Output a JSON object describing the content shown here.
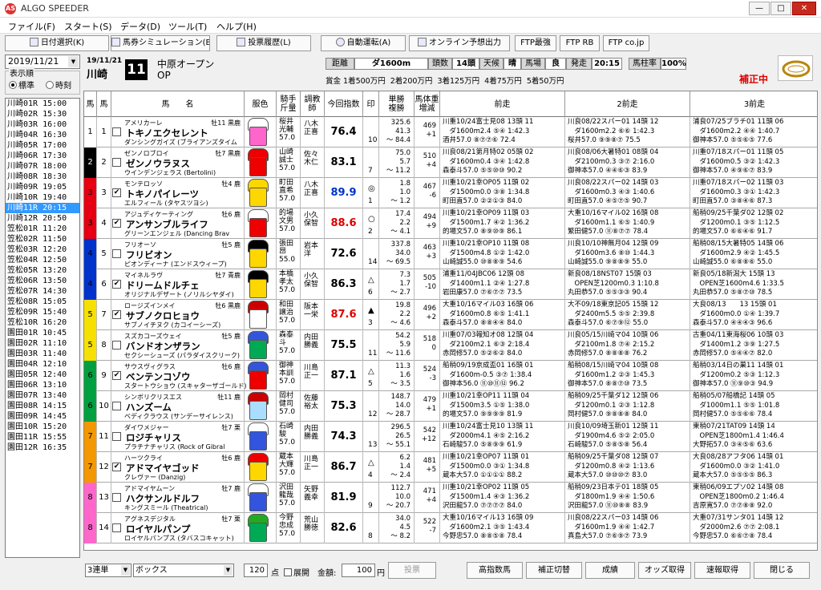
{
  "window": {
    "title": "ALGO SPEEDER",
    "app_icon": "AS"
  },
  "menu": [
    "ファイル(F)",
    "スタート(S)",
    "データ(D)",
    "ツール(T)",
    "ヘルプ(H)"
  ],
  "toolbar": [
    {
      "label": "日付選択(K)",
      "icon": "search-icon"
    },
    {
      "label": "馬券シミュレーション(B)",
      "icon": "ticket-icon"
    },
    {
      "label": "投票履歴(L)",
      "icon": "document-icon"
    },
    {
      "label": "自動運転(A)",
      "icon": "disc-icon"
    },
    {
      "label": "オンライン予想出力",
      "icon": "document-icon"
    },
    {
      "label": "FTP最強",
      "icon": ""
    },
    {
      "label": "FTP RB",
      "icon": ""
    },
    {
      "label": "FTP co.jp",
      "icon": ""
    }
  ],
  "left": {
    "date": "2019/11/21",
    "order_label": "表示順",
    "order_std": "標準",
    "order_time": "時刻",
    "races": [
      "川崎01R 15:00",
      "川崎02R 15:30",
      "川崎03R 16:00",
      "川崎04R 16:30",
      "川崎05R 17:00",
      "川崎06R 17:30",
      "川崎07R 18:00",
      "川崎08R 18:30",
      "川崎09R 19:05",
      "川崎10R 19:40",
      "川崎11R 20:15",
      "川崎12R 20:50",
      "笠松01R 11:20",
      "笠松02R 11:50",
      "笠松03R 12:20",
      "笠松04R 12:50",
      "笠松05R 13:20",
      "笠松06R 13:50",
      "笠松07R 14:30",
      "笠松08R 15:05",
      "笠松09R 15:40",
      "笠松10R 16:20",
      "園田01R 10:45",
      "園田02R 11:10",
      "園田03R 11:40",
      "園田04R 12:10",
      "園田05R 12:40",
      "園田06R 13:10",
      "園田07R 13:40",
      "園田08R 14:15",
      "園田09R 14:45",
      "園田10R 15:20",
      "園田11R 15:55",
      "園田12R 16:35"
    ],
    "selected": 10
  },
  "race": {
    "date": "19/11/21",
    "venue": "川崎",
    "number": "11",
    "name": "中原オープン",
    "class": "OP",
    "dist_label": "距離",
    "dist": "ダ1600m",
    "heads_label": "頭数",
    "heads": "14頭",
    "weather_label": "天候",
    "weather": "晴",
    "track_label": "馬場",
    "track": "良",
    "post_label": "発走",
    "post": "20:15",
    "rate_label": "馬柱率",
    "rate": "100%",
    "prize": "賞金 1着500万円  2着200万円  3着125万円  4着75万円  5着50万円",
    "hosei": "補正中"
  },
  "columns": [
    "馬",
    "馬",
    "馬　　名",
    "服色",
    "騎手\n斤量",
    "調教師",
    "今回指数",
    "印",
    "単勝\n複勝",
    "馬体重\n増減",
    "前走",
    "2前走",
    "3前走"
  ],
  "horses": [
    {
      "waku": "1",
      "num": "1",
      "chk": false,
      "sire": "アメリカーレ",
      "sex": "牡11 黒鹿",
      "name": "トキノエクセレント",
      "dam": "ダンシングガイズ (ブライアンズタイム",
      "jockey": "桜井\n光輔\n57.0",
      "trainer": "八木\n正喜",
      "index": "76.4",
      "idxcolor": "#000",
      "mark": "",
      "rank": "10",
      "odds": "325.6\n41.3\n～ 84.4",
      "weight": "469\n+1",
      "p1": "川重10/24富士見08 13頭 11\n　ダ1600m2.4 ⑤④ 1:42.3\n酒井57.0 ⑧⑦⑦⑥ 72.4",
      "p2": "川良08/22スパー01 14頭 12\n　ダ1600m2.2 ⑥⑥ 1:42.3\n桜井57.0 ⑨⑨⑧⑦ 75.5",
      "p3": "浦良07/25ブラチ01 11頭 06\n　ダ1600m2.2 ④④ 1:40.7\n御神本57.0 ⑤⑤⑥⑤ 77.6"
    },
    {
      "waku": "2",
      "num": "2",
      "chk": false,
      "sire": "ゼンノロブロイ",
      "sex": "牡7 黒鹿",
      "name": "ゼンノウラヌス",
      "dam": "ウインデンジェラス (Bertolini)",
      "jockey": "山崎\n誠士\n57.0",
      "trainer": "佐々\n木仁",
      "index": "83.1",
      "idxcolor": "#000",
      "mark": "",
      "rank": "7",
      "odds": "75.0\n5.7\n～ 11.2",
      "weight": "510\n+4",
      "p1": "川良08/21第月特02 05頭 02\n　ダ1600m0.4 ③④ 1:42.8\n森泰斗57.0 ⑤⑤⑩⑩ 90.2",
      "p2": "川良08/06大暑特01 08頭 04\n　ダ2100m0.3 ③⑦ 2:16.0\n御神本57.0 ④④⑥③ 83.9",
      "p3": "川重07/18スパー01 11頭 05\n　ダ1600m0.5 ③② 1:42.3\n御神本57.0 ④⑨⑥⑦ 83.9"
    },
    {
      "waku": "3",
      "num": "3",
      "chk": true,
      "sire": "モンテロッソ",
      "sex": "牡4 鹿",
      "name": "トキノパイレーツ",
      "dam": "エルフィール (タヤスツヨシ)",
      "jockey": "町田\n直希\n57.0",
      "trainer": "八木\n正喜",
      "index": "89.9",
      "idxcolor": "#0033cc",
      "mark": "◎",
      "rank": "1",
      "odds": "1.8\n1.0\n～ 1.2",
      "weight": "467\n-6",
      "p1": "川重10/21幸OP05 11頭 02\n　ダ1500m0.0 ③⑧ 1:34.8\n町田直57.0 ②②①③ 84.0",
      "p2": "川良08/22スパー02 14頭 03\n　ダ1600m0.3 ④③ 1:40.6\n町田直57.0 ④⑤⑦⑤ 90.7",
      "p3": "川重07/18スパー02 11頭 03\n　ダ1600m0.3 ③① 1:42.3\n町田直57.0 ③⑧④⑥ 87.3"
    },
    {
      "waku": "3",
      "num": "4",
      "chk": true,
      "sire": "アジュディケーティング",
      "sex": "牡6 鹿",
      "name": "アンサンブルライフ",
      "dam": "グリーンエンジェル (Dancing Brav",
      "jockey": "的場\n文男\n57.0",
      "trainer": "小久\n保智",
      "index": "88.6",
      "idxcolor": "#d00",
      "mark": "○",
      "rank": "2",
      "odds": "17.4\n2.2\n～ 4.1",
      "weight": "494\n+9",
      "p1": "川重10/21幸OP09 11頭 03\n　ダ1500m1.7 ④② 1:36.2\n的場文57.0 ⑧⑨⑩⑨ 86.1",
      "p2": "大重10/16マイル02 16頭 08\n　ダ1600m1.1 ⑥⑤ 1:40.9\n繁田健57.0 ⑪⑧⑦⑦ 78.4",
      "p3": "船稍09/25千葉ダ02 12頭 02\n　ダ1200m0.1 ③⑤ 1:12.5\n的場文57.0 ⑥⑥④⑥ 91.7"
    },
    {
      "waku": "4",
      "num": "5",
      "chk": false,
      "sire": "フリオーソ",
      "sex": "牡5 鹿",
      "name": "フリビオン",
      "dam": "ピオンディーナ (エンドスウィープ)",
      "jockey": "張田\n昂\n55.0",
      "trainer": "岩本\n洋",
      "index": "72.6",
      "idxcolor": "#000",
      "mark": "",
      "rank": "14",
      "odds": "337.8\n34.0\n～ 69.5",
      "weight": "463\n+3",
      "p1": "川重10/21幸OP10 11頭 08\n　ダ1500m4.8 ①② 1:42.0\n山崎誠55.0 ⑩⑧⑧⑨ 54.6",
      "p2": "川良10/10神無月04 12頭 09\n　ダ1600m3.6 ⑧⑩ 1:44.3\n山崎誠55.0 ⑨⑧⑧⑨ 55.0",
      "p3": "船稍08/15大暑特05 14頭 06\n　ダ1600m2.9 ④② 1:45.5\n山崎誠55.0 ⑥⑧⑧⑥ 55.0"
    },
    {
      "waku": "4",
      "num": "6",
      "chk": true,
      "sire": "マイネルラヴ",
      "sex": "牡7 青鹿",
      "name": "ドリームドルチェ",
      "dam": "オリジナルデザート (ノリルシヤダイ)",
      "jockey": "本橋\n孝太\n57.0",
      "trainer": "小久\n保智",
      "index": "86.3",
      "idxcolor": "#000",
      "mark": "△",
      "rank": "6",
      "odds": "7.3\n1.7\n～ 2.7",
      "weight": "505\n-10",
      "p1": "浦重11/04JBC06 12頭 08\n　ダ1400m1.1 ②④ 1:27.8\n岩田康57.0 ⑦⑥⑦⑦ 73.5",
      "p2": "新良08/18NST07 15頭 03\n　OPEN芝1200m0.3 1:10.8\n丸田恭57.0 ⑤⑤③③ 90.4",
      "p3": "新良05/18新潟大 15頭 13\n　OPEN芝1600m4.6 1:33.5\n丸田恭57.0 ⑤⑧⑦⑩ 78.5"
    },
    {
      "waku": "5",
      "num": "7",
      "chk": true,
      "sire": "ロージズインメイ",
      "sex": "牡6 黒鹿",
      "name": "サブノクロヒョウ",
      "dam": "サブノイチヌク (カコイーシーズ)",
      "jockey": "和田\n譲治\n57.0",
      "trainer": "阪本\n一栄",
      "index": "87.6",
      "idxcolor": "#d00",
      "mark": "▲",
      "rank": "3",
      "odds": "19.8\n2.2\n～ 4.6",
      "weight": "496\n+2",
      "p1": "大重10/16マイル03 16頭 06\n　ダ1600m0.8 ⑥⑤ 1:41.1\n森泰斗57.0 ⑧⑧④④ 84.0",
      "p2": "大不09/18東京記05 15頭 12\n　ダ2400m5.5 ⑤⑤ 2:39.8\n森泰斗57.0 ⑥⑦⑨⑫ 55.0",
      "p3": "大良08/13　　13 15頭 01\n　ダ1600m0.0 ①④ 1:39.7\n森泰斗57.0 ④④④③ 96.6"
    },
    {
      "waku": "5",
      "num": "8",
      "chk": false,
      "sire": "スズカコーズウェイ",
      "sex": "牡5 鹿",
      "name": "バンドオンザラン",
      "dam": "セクシーシューズ (パラダイスクリーク)",
      "jockey": "森泰\n斗\n57.0",
      "trainer": "内田\n勝義",
      "index": "75.5",
      "idxcolor": "#000",
      "mark": "",
      "rank": "11",
      "odds": "54.2\n5.9\n～ 11.6",
      "weight": "518\n0",
      "p1": "川重07/03報知オ08 12頭 04\n　ダ2100m2.1 ⑥③ 2:18.4\n赤岡修57.0 ⑤②⑥② 84.0",
      "p2": "川良05/15川崎マ04 10頭 06\n　ダ2100m1.8 ⑦④ 2:15.2\n赤岡修57.0 ⑧⑧⑧⑧ 76.2",
      "p3": "古重04/11東海桜06 10頭 03\n　ダ1400m1.2 ③⑨ 1:27.5\n赤岡修57.0 ⑤④④⑦ 82.0"
    },
    {
      "waku": "6",
      "num": "9",
      "chk": true,
      "sire": "サウスヴィグラス",
      "sex": "牡6 鹿",
      "name": "ベンテンコゾウ",
      "dam": "スタートウショウ (スキャターザゴールド)",
      "jockey": "御神\n本訓\n57.0",
      "trainer": "川島\n正一",
      "index": "87.1",
      "idxcolor": "#000",
      "mark": "△",
      "rank": "5",
      "odds": "11.3\n1.6\n～ 3.5",
      "weight": "524\n-3",
      "p1": "船稍09/19京成盃01 16頭 01\n　ダ1600m-0.5 ③⑦ 1:38.4\n御神本56.0 ⑪⑩⑪⑫ 96.2",
      "p2": "船稍08/15川崎マ04 10頭 08\n　ダ1600m1.2 ②③ 1:45.3\n御神本57.0 ⑧⑧⑦⑩ 73.5",
      "p3": "船稍03/14日の菓11 14頭 01\n　ダ1200m0.2 ⑤③ 1:12.3\n御神本57.0 ⑪⑨⑩③ 94.9"
    },
    {
      "waku": "6",
      "num": "10",
      "chk": false,
      "sire": "シンボリクリスエス",
      "sex": "牡11 鹿",
      "name": "ハンズーム",
      "dam": "ベディクラウス (サンデーサイレンス)",
      "jockey": "岡村\n健司\n57.0",
      "trainer": "佐藤\n裕太",
      "index": "75.3",
      "idxcolor": "#000",
      "mark": "",
      "rank": "12",
      "odds": "148.7\n14.0\n～ 28.7",
      "weight": "479\n+1",
      "p1": "川重10/21幸OP11 11頭 04\n　ダ1500m3.5 ①⑤ 1:38.0\n的場文57.0 ⑨⑨⑨⑨ 81.9",
      "p2": "船稍09/25千葉ダ12 12頭 06\n　ダ1200m0.1 ②③ 1:12.8\n岡村健57.0 ⑨⑧⑧⑧ 84.0",
      "p3": "船稍05/07船橋記 14頭 05\n　ダ1000m1.1 ⑤⑤ 1:01.8\n岡村健57.0 ⑤⑤⑥⑥ 78.4"
    },
    {
      "waku": "7",
      "num": "11",
      "chk": false,
      "sire": "ダイワメジャー",
      "sex": "牡7 栗",
      "name": "ロジチャリス",
      "dam": "プラチナチャリス (Rock of Gibral",
      "jockey": "石崎\n駿\n57.0",
      "trainer": "内田\n勝義",
      "index": "74.3",
      "idxcolor": "#000",
      "mark": "",
      "rank": "13",
      "odds": "296.5\n26.5\n～ 55.1",
      "weight": "542\n+12",
      "p1": "川重10/24富士見10 13頭 11\n　ダ2000m4.1 ④⑤ 2:16.2\n石崎駿57.0 ⑤⑧⑨⑨ 61.9",
      "p2": "川良10/09埼玉新01 12頭 11\n　ダ1900m4.6 ⑤② 2:05.0\n石崎駿57.0 ⑤⑧⑤⑧ 56.4",
      "p3": "東稍07/21TAT09 14頭 14\n　OPEN芝1800m1.4 1:46.4\n大野拓57.0 ③④⑤⑥ 63.6"
    },
    {
      "waku": "7",
      "num": "12",
      "chk": true,
      "sire": "ハーツクライ",
      "sex": "牡6 鹿",
      "name": "アドマイヤゴッド",
      "dam": "クレヴァー (Danzig)",
      "jockey": "蔵本\n大輝\n57.0",
      "trainer": "川島\n正一",
      "index": "86.7",
      "idxcolor": "#000",
      "mark": "△",
      "rank": "4",
      "odds": "6.2\n1.4\n～ 2.4",
      "weight": "481\n+5",
      "p1": "川重10/21幸OP07 11頭 01\n　ダ1500m0.0 ③① 1:34.8\n蔵本大57.0 ①①①① 88.2",
      "p2": "船稍09/25千葉ダ08 12頭 07\n　ダ1200m0.8 ④② 1:13.6\n蔵本大57.0 ⑩⑩⑩⑦ 83.0",
      "p3": "大良08/28アフタ06 14頭 01\n　ダ1600m0.0 ③② 1:41.0\n蔵本大57.0 ⑤⑤⑤⑤ 86.3"
    },
    {
      "waku": "8",
      "num": "13",
      "chk": false,
      "sire": "アドマイヤムーン",
      "sex": "牡7 鹿",
      "name": "ハクサンルドルフ",
      "dam": "キングスミール (Theatrical)",
      "jockey": "沢田\n龍哉\n57.0",
      "trainer": "矢野\n義幸",
      "index": "81.9",
      "idxcolor": "#000",
      "mark": "",
      "rank": "9",
      "odds": "112.7\n10.0\n～ 20.7",
      "weight": "471\n+4",
      "p1": "川重10/21幸OP02 11頭 05\n　ダ1500m1.4 ④③ 1:36.2\n沢田龍57.0 ⑦⑦⑦⑦ 84.0",
      "p2": "船稍09/23日本テ01 18頭 05\n　ダ1800m1.9 ④④ 1:50.6\n沢田龍57.0 ⑪⑩⑧⑧ 83.9",
      "p3": "東稍06/09エプソ02 14頭 08\n　OPEN芝1800m0.2 1:46.4\n吉原寛57.0 ⑦⑦⑧⑧ 92.0"
    },
    {
      "waku": "8",
      "num": "14",
      "chk": false,
      "sire": "アグネスデジタル",
      "sex": "牡7 栗",
      "name": "ロイヤルパンプ",
      "dam": "ロイヤルパンプス (タバスコキャット)",
      "jockey": "今野\n忠成\n57.0",
      "trainer": "荒山\n勝徳",
      "index": "82.6",
      "idxcolor": "#000",
      "mark": "",
      "rank": "8",
      "odds": "34.0\n4.5\n～ 8.2",
      "weight": "522\n-7",
      "p1": "大重10/16マイル13 16頭 09\n　ダ1600m2.1 ③⑤ 1:43.4\n今野忠57.0 ⑧⑧⑤⑧ 78.4",
      "p2": "川良08/22スパー03 14頭 06\n　ダ1600m1.9 ④④ 1:42.7\n真島大57.0 ⑦⑥⑨⑦ 73.9",
      "p3": "大重07/31サンタ01 14頭 12\n　ダ2000m2.6 ⑦⑦ 2:08.1\n今野忠57.0 ⑥⑥⑦⑧ 78.4"
    }
  ],
  "bottom": {
    "type": "3連単",
    "method": "ボックス",
    "points": "120",
    "points_unit": "点",
    "expand": "展開",
    "amount_label": "金額:",
    "amount": "100",
    "yen": "円",
    "vote": "投票",
    "b1": "高指数馬",
    "b2": "補正切替",
    "b3": "成績",
    "b4": "オッズ取得",
    "b5": "速報取得",
    "b6": "閉じる"
  },
  "colors": {
    "waku": [
      "#ffffff",
      "#000000",
      "#e60012",
      "#0033cc",
      "#f5e000",
      "#00a040",
      "#f39800",
      "#ff66cc"
    ]
  }
}
